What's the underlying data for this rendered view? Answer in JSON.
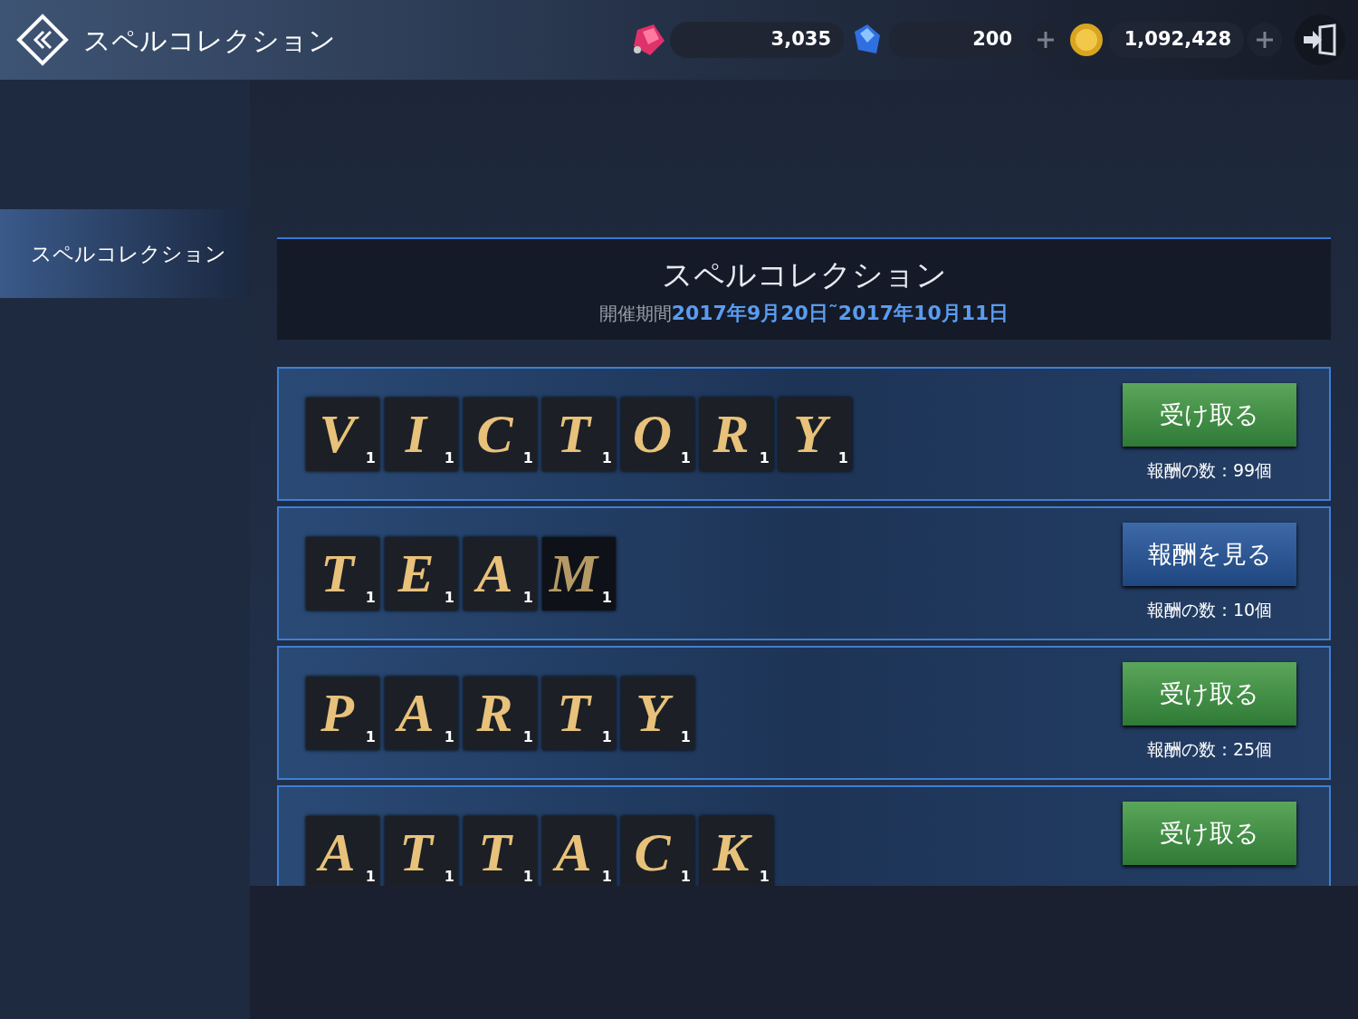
{
  "header": {
    "title": "スペルコレクション",
    "currencies": [
      {
        "kind": "ruby",
        "amount": "3,035",
        "addable": false
      },
      {
        "kind": "sapphire",
        "amount": "200",
        "addable": true
      },
      {
        "kind": "coin",
        "amount": "1,092,428",
        "addable": true
      }
    ]
  },
  "sidebar": {
    "items": [
      {
        "label": "スペルコレクション",
        "selected": true
      }
    ]
  },
  "event": {
    "title": "スペルコレクション",
    "period_label": "開催期間",
    "period": "2017年9月20日˜2017年10月11日"
  },
  "spells": [
    {
      "tiles": [
        {
          "letter": "V",
          "count": "1",
          "dim": false
        },
        {
          "letter": "I",
          "count": "1",
          "dim": false
        },
        {
          "letter": "C",
          "count": "1",
          "dim": false
        },
        {
          "letter": "T",
          "count": "1",
          "dim": false
        },
        {
          "letter": "O",
          "count": "1",
          "dim": false
        },
        {
          "letter": "R",
          "count": "1",
          "dim": false
        },
        {
          "letter": "Y",
          "count": "1",
          "dim": false
        }
      ],
      "button": {
        "kind": "claim",
        "label": "受け取る"
      },
      "reward": "報酬の数：99個"
    },
    {
      "tiles": [
        {
          "letter": "T",
          "count": "1",
          "dim": false
        },
        {
          "letter": "E",
          "count": "1",
          "dim": false
        },
        {
          "letter": "A",
          "count": "1",
          "dim": false
        },
        {
          "letter": "M",
          "count": "1",
          "dim": true
        }
      ],
      "button": {
        "kind": "view",
        "label": "報酬を見る"
      },
      "reward": "報酬の数：10個"
    },
    {
      "tiles": [
        {
          "letter": "P",
          "count": "1",
          "dim": false
        },
        {
          "letter": "A",
          "count": "1",
          "dim": false
        },
        {
          "letter": "R",
          "count": "1",
          "dim": false
        },
        {
          "letter": "T",
          "count": "1",
          "dim": false
        },
        {
          "letter": "Y",
          "count": "1",
          "dim": false
        }
      ],
      "button": {
        "kind": "claim",
        "label": "受け取る"
      },
      "reward": "報酬の数：25個"
    },
    {
      "tiles": [
        {
          "letter": "A",
          "count": "1",
          "dim": false
        },
        {
          "letter": "T",
          "count": "1",
          "dim": false
        },
        {
          "letter": "T",
          "count": "1",
          "dim": false
        },
        {
          "letter": "A",
          "count": "1",
          "dim": false
        },
        {
          "letter": "C",
          "count": "1",
          "dim": false
        },
        {
          "letter": "K",
          "count": "1",
          "dim": false
        }
      ],
      "button": {
        "kind": "claim",
        "label": "受け取る"
      }
    }
  ]
}
